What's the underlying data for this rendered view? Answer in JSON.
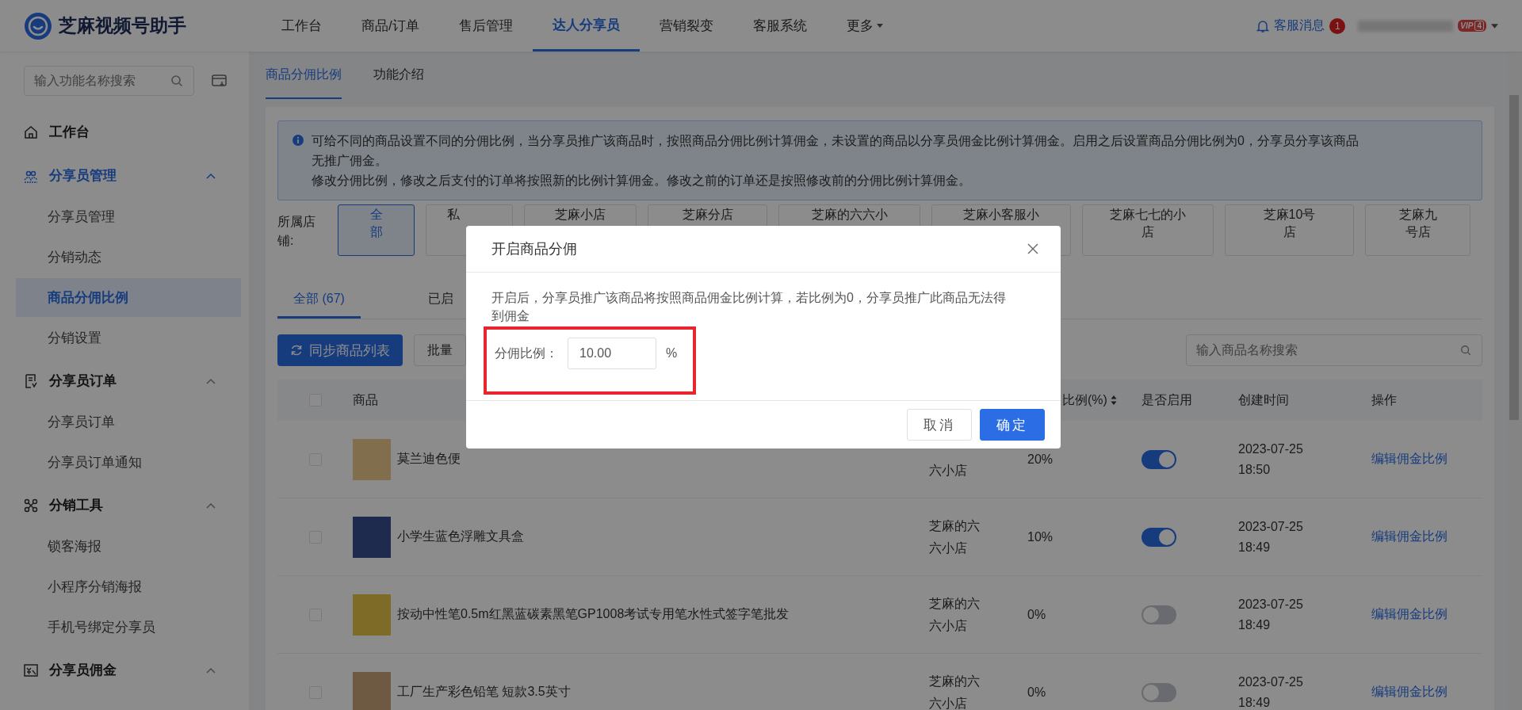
{
  "header": {
    "logo_text": "芝麻视频号助手",
    "nav": [
      {
        "label": "工作台",
        "selected": false,
        "has_caret": false
      },
      {
        "label": "商品/订单",
        "selected": false,
        "has_caret": false
      },
      {
        "label": "售后管理",
        "selected": false,
        "has_caret": false
      },
      {
        "label": "达人分享员",
        "selected": true,
        "has_caret": false
      },
      {
        "label": "营销裂变",
        "selected": false,
        "has_caret": false
      },
      {
        "label": "客服系统",
        "selected": false,
        "has_caret": false
      },
      {
        "label": "更多",
        "selected": false,
        "has_caret": true
      }
    ],
    "messages": {
      "label": "客服消息",
      "badge": "1"
    },
    "vip_label": "VIP",
    "vip_rank": "4"
  },
  "sidebar": {
    "search": {
      "placeholder": "输入功能名称搜索"
    },
    "groups": [
      {
        "label": "工作台",
        "selected": false
      },
      {
        "label": "分享员管理",
        "selected": true,
        "expanded": true,
        "children": [
          {
            "label": "分享员管理",
            "selected": false
          },
          {
            "label": "分销动态",
            "selected": false
          },
          {
            "label": "商品分佣比例",
            "selected": true
          },
          {
            "label": "分销设置",
            "selected": false
          }
        ]
      },
      {
        "label": "分享员订单",
        "selected": false,
        "expanded": true,
        "children": [
          {
            "label": "分享员订单",
            "selected": false
          },
          {
            "label": "分享员订单通知",
            "selected": false
          }
        ]
      },
      {
        "label": "分销工具",
        "selected": false,
        "expanded": true,
        "children": [
          {
            "label": "锁客海报",
            "selected": false
          },
          {
            "label": "小程序分销海报",
            "selected": false
          },
          {
            "label": "手机号绑定分享员",
            "selected": false
          }
        ]
      },
      {
        "label": "分享员佣金",
        "selected": false,
        "expanded": true
      }
    ]
  },
  "page_tabs": [
    {
      "label": "商品分佣比例",
      "selected": true
    },
    {
      "label": "功能介绍",
      "selected": false
    }
  ],
  "notice": {
    "paragraphs": [
      "可给不同的商品设置不同的分佣比例，当分享员推广该商品时，按照商品分佣比例计算佣金，未设置的商品以分享员佣金比例计算佣金。启用之后设置商品分佣比例为0，分享员分享该商品无推广佣金。",
      "修改分佣比例，修改之后支付的订单将按照新的比例计算佣金。修改之前的订单还是按照修改前的分佣比例计算佣金。"
    ]
  },
  "store_filter": {
    "label": "所属店铺:",
    "stores": [
      {
        "label": "全部",
        "selected": true
      },
      {
        "label": "私",
        "selected": false
      },
      {
        "label": "芝麻小店",
        "selected": false
      },
      {
        "label": "芝麻分店",
        "selected": false
      },
      {
        "label": "芝麻的六六小",
        "selected": false
      },
      {
        "label": "芝麻小客服小",
        "selected": false
      },
      {
        "label": "芝麻七七的小店",
        "selected": false
      },
      {
        "label": "芝麻10号店",
        "selected": false
      },
      {
        "label": "芝麻九号店",
        "selected": false
      }
    ]
  },
  "status_tabs": [
    {
      "label": "全部 (67)",
      "selected": true
    },
    {
      "label": "已启",
      "selected": false
    }
  ],
  "toolbar": {
    "sync_button": "同步商品列表",
    "batch_button": "批量",
    "search": {
      "placeholder": "输入商品名称搜索"
    }
  },
  "table": {
    "select_all": {
      "checked": false
    },
    "columns": [
      {
        "kind": "product",
        "label": "商品",
        "sortable": false
      },
      {
        "kind": "ratio",
        "label": "比例(%)",
        "sortable": true
      },
      {
        "kind": "enabled",
        "label": "是否启用",
        "sortable": false
      },
      {
        "kind": "time",
        "label": "创建时间",
        "sortable": false
      },
      {
        "kind": "action",
        "label": "操作",
        "sortable": false
      }
    ],
    "rows": [
      {
        "checked": false,
        "product": "莫兰迪色便",
        "store_lines": [
          "六小店"
        ],
        "ratio": "20%",
        "enabled": true,
        "created_date": "2023-07-25",
        "created_time": "18:50",
        "action": "编辑佣金比例"
      },
      {
        "checked": false,
        "product": "小学生蓝色浮雕文具盒",
        "store_lines": [
          "芝麻的六",
          "六小店"
        ],
        "ratio": "10%",
        "enabled": true,
        "created_date": "2023-07-25",
        "created_time": "18:49",
        "action": "编辑佣金比例"
      },
      {
        "checked": false,
        "product": "按动中性笔0.5m红黑蓝碳素黑笔GP1008考试专用笔水性式签字笔批发",
        "store_lines": [
          "芝麻的六",
          "六小店"
        ],
        "ratio": "0%",
        "enabled": false,
        "created_date": "2023-07-25",
        "created_time": "18:49",
        "action": "编辑佣金比例"
      },
      {
        "checked": false,
        "product": "工厂生产彩色铅笔 短款3.5英寸",
        "store_lines": [
          "芝麻的六",
          "六小店"
        ],
        "ratio": "0%",
        "enabled": false,
        "created_date": "2023-07-25",
        "created_time": "18:49",
        "action": "编辑佣金比例"
      }
    ]
  },
  "modal": {
    "title": "开启商品分佣",
    "message": "开启后，分享员推广该商品将按照商品佣金比例计算，若比例为0，分享员推广此商品无法得到佣金",
    "field": {
      "label": "分佣比例：",
      "value": "10.00",
      "unit": "%",
      "highlighted": true
    },
    "buttons": [
      {
        "label": "取消",
        "kind": "secondary"
      },
      {
        "label": "确定",
        "kind": "primary"
      }
    ]
  }
}
